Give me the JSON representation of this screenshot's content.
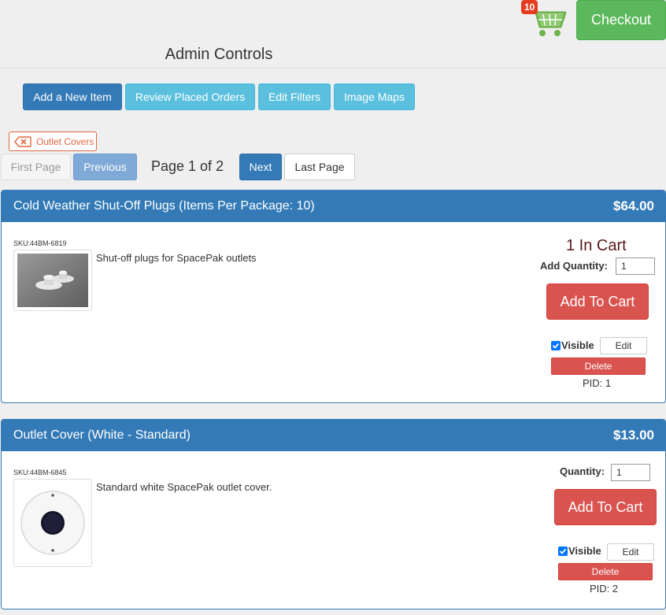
{
  "header": {
    "cart_count": "10",
    "checkout_label": "Checkout",
    "admin_title": "Admin Controls"
  },
  "admin_buttons": {
    "add_item": "Add a New Item",
    "review_orders": "Review Placed Orders",
    "edit_filters": "Edit Filters",
    "image_maps": "Image Maps"
  },
  "filter": {
    "active_tag": "Outlet Covers"
  },
  "pagination": {
    "first": "First Page",
    "previous": "Previous",
    "info": "Page 1 of 2",
    "next": "Next",
    "last": "Last Page"
  },
  "products": [
    {
      "title": "Cold Weather Shut-Off Plugs (Items Per Package: 10)",
      "price": "$64.00",
      "sku": "SKU:44BM-6819",
      "description": "Shut-off plugs for SpacePak outlets",
      "in_cart": "1 In Cart",
      "qty_label": "Add Quantity:",
      "qty_value": "1",
      "add_label": "Add To Cart",
      "visible_label": "Visible",
      "visible_checked": true,
      "edit_label": "Edit",
      "delete_label": "Delete",
      "pid": "PID: 1"
    },
    {
      "title": "Outlet Cover (White - Standard)",
      "price": "$13.00",
      "sku": "SKU:44BM-6845",
      "description": "Standard white SpacePak outlet cover.",
      "qty_label": "Quantity:",
      "qty_value": "1",
      "add_label": "Add To Cart",
      "visible_label": "Visible",
      "visible_checked": true,
      "edit_label": "Edit",
      "delete_label": "Delete",
      "pid": "PID: 2"
    }
  ],
  "colors": {
    "primary": "#337ab7",
    "info": "#5bc0de",
    "success": "#5cb85c",
    "danger": "#d9534f",
    "filter_tag": "#e0663f"
  }
}
